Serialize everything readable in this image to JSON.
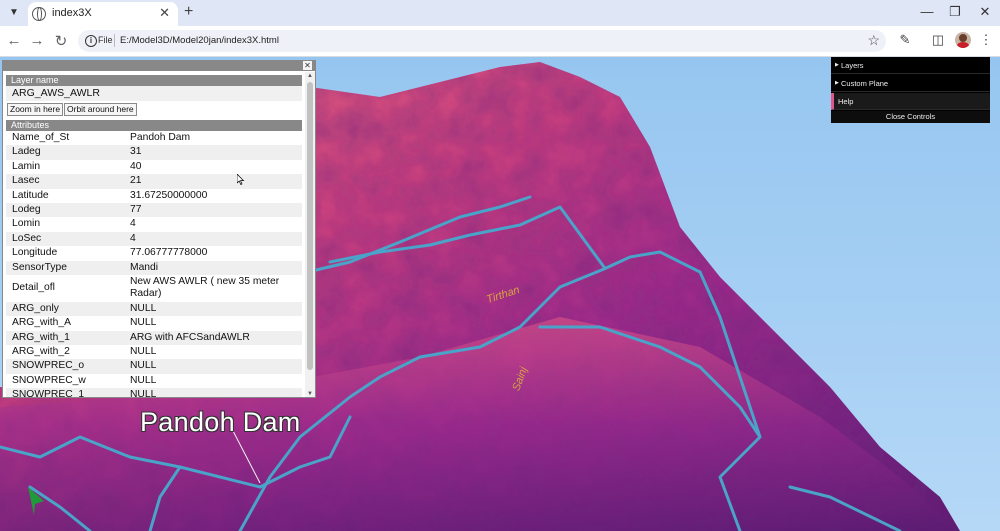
{
  "browser": {
    "tab_title": "index3X",
    "url_scheme": "File",
    "url": "E:/Model3D/Model20jan/index3X.html"
  },
  "panel": {
    "layer_header": "Layer name",
    "layer_name": "ARG_AWS_AWLR",
    "zoom_button": "Zoom in here",
    "orbit_button": "Orbit around here",
    "attributes_header": "Attributes",
    "attributes": [
      {
        "key": "Name_of_St",
        "value": "Pandoh Dam"
      },
      {
        "key": "Ladeg",
        "value": "31"
      },
      {
        "key": "Lamin",
        "value": "40"
      },
      {
        "key": "Lasec",
        "value": "21"
      },
      {
        "key": "Latitude",
        "value": "31.67250000000"
      },
      {
        "key": "Lodeg",
        "value": "77"
      },
      {
        "key": "Lomin",
        "value": "4"
      },
      {
        "key": "LoSec",
        "value": "4"
      },
      {
        "key": "Longitude",
        "value": "77.06777778000"
      },
      {
        "key": "SensorType",
        "value": "Mandi"
      },
      {
        "key": "Detail_ofl",
        "value": "New AWS AWLR ( new 35 meter Radar)"
      },
      {
        "key": "ARG_only",
        "value": "NULL"
      },
      {
        "key": "ARG_with_A",
        "value": "NULL"
      },
      {
        "key": "ARG_with_1",
        "value": "ARG with AFCSandAWLR"
      },
      {
        "key": "ARG_with_2",
        "value": "NULL"
      },
      {
        "key": "SNOWPREC_o",
        "value": "NULL"
      },
      {
        "key": "SNOWPREC_w",
        "value": "NULL"
      },
      {
        "key": "SNOWPREC_1",
        "value": "NULL"
      }
    ]
  },
  "scene": {
    "place_label_part1": "Pandoh",
    "place_label_part2": " Dam",
    "terrain_label_1": "Tirthan",
    "terrain_label_2": "Sainj"
  },
  "controls": {
    "items": [
      "Layers",
      "Custom Plane",
      "Help"
    ],
    "close_label": "Close Controls"
  },
  "colors": {
    "terrain_high": "#e8557a",
    "terrain_mid": "#b0308c",
    "terrain_low": "#6a1a78",
    "river": "#4aa3c8",
    "sky": "#a0cbf2"
  },
  "icons": [
    "tab-list-icon",
    "globe-icon",
    "close-icon",
    "plus-icon",
    "minimize-icon",
    "restore-icon",
    "back-icon",
    "forward-icon",
    "reload-icon",
    "info-icon",
    "star-icon",
    "extensions-icon",
    "sidebar-icon",
    "avatar",
    "menu-icon"
  ]
}
